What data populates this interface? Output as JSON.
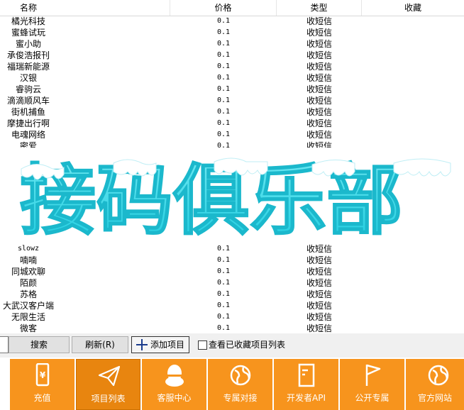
{
  "table": {
    "headers": {
      "name": "名称",
      "price": "价格",
      "type": "类型",
      "favorite": "收藏"
    },
    "rows": [
      {
        "name": "橘光科技",
        "price": "0.1",
        "type": "收短信"
      },
      {
        "name": "蜜蜂试玩",
        "price": "0.1",
        "type": "收短信"
      },
      {
        "name": "蜜小助",
        "price": "0.1",
        "type": "收短信"
      },
      {
        "name": "承俊浩报刊",
        "price": "0.1",
        "type": "收短信"
      },
      {
        "name": "福瑞新能源",
        "price": "0.1",
        "type": "收短信"
      },
      {
        "name": "汉银",
        "price": "0.1",
        "type": "收短信"
      },
      {
        "name": "睿驹云",
        "price": "0.1",
        "type": "收短信"
      },
      {
        "name": "滴滴顺风车",
        "price": "0.1",
        "type": "收短信"
      },
      {
        "name": "街机捕鱼",
        "price": "0.1",
        "type": "收短信"
      },
      {
        "name": "摩捷出行啊",
        "price": "0.1",
        "type": "收短信"
      },
      {
        "name": "电魂网络",
        "price": "0.1",
        "type": "收短信"
      },
      {
        "name": "密爱",
        "price": "0.1",
        "type": "收短信"
      }
    ],
    "rows_after": [
      {
        "name": "slowz",
        "price": "0.1",
        "type": "收短信"
      },
      {
        "name": "喃喃",
        "price": "0.1",
        "type": "收短信"
      },
      {
        "name": "同城欢聊",
        "price": "0.1",
        "type": "收短信"
      },
      {
        "name": "陌颜",
        "price": "0.1",
        "type": "收短信"
      },
      {
        "name": "苏格",
        "price": "0.1",
        "type": "收短信"
      },
      {
        "name": "大武汉客户端",
        "price": "0.1",
        "type": "收短信"
      },
      {
        "name": "无限生活",
        "price": "0.1",
        "type": "收短信"
      },
      {
        "name": "微客",
        "price": "0.1",
        "type": "收短信"
      }
    ]
  },
  "watermark": {
    "text": "接码俱乐部",
    "color": "#2ed6e6"
  },
  "toolbar": {
    "search_label": "搜索",
    "refresh_label": "刷新(R)",
    "add_label": "添加项目",
    "show_favorites_label": "查看已收藏项目列表"
  },
  "nav": [
    {
      "label": "充值",
      "icon": "phone-yen-icon"
    },
    {
      "label": "项目列表",
      "icon": "paper-plane-icon",
      "active": true
    },
    {
      "label": "客服中心",
      "icon": "qq-penguin-icon"
    },
    {
      "label": "专属对接",
      "icon": "globe-icon"
    },
    {
      "label": "开发者API",
      "icon": "document-icon"
    },
    {
      "label": "公开专属",
      "icon": "flag-icon"
    },
    {
      "label": "官方网站",
      "icon": "globe-icon"
    }
  ],
  "colors": {
    "nav_bg": "#f7941d",
    "nav_active_bg": "#e8850f",
    "add_icon": "#1a3c8c"
  }
}
